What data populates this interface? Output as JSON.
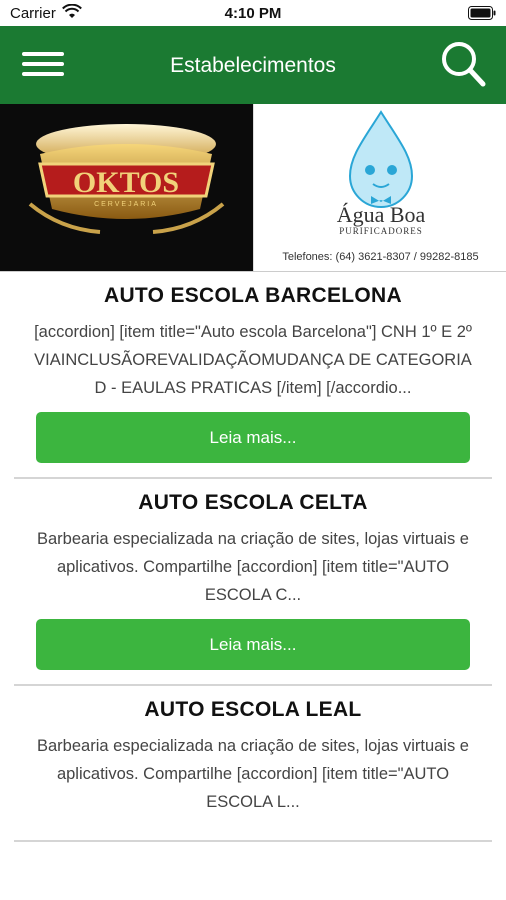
{
  "status_bar": {
    "carrier": "Carrier",
    "time": "4:10 PM"
  },
  "nav": {
    "title": "Estabelecimentos"
  },
  "banner": {
    "left_brand": "OKTOS",
    "left_sub": "CERVEJARIA",
    "right_brand": "Água Boa",
    "right_sub": "PURIFICADORES",
    "right_phones": "Telefones: (64) 3621-8307 / 99282-8185"
  },
  "items": [
    {
      "title": "AUTO ESCOLA BARCELONA",
      "description": "[accordion] [item title=\"Auto escola Barcelona\"] CNH 1º E 2º VIAINCLUSÃOREVALIDAÇÃOMUDANÇA DE CATEGORIA D - EAULAS PRATICAS [/item] [/accordio...",
      "button": "Leia mais..."
    },
    {
      "title": "AUTO ESCOLA CELTA",
      "description": "Barbearia especializada na criação de sites, lojas virtuais e aplicativos.  Compartilhe   [accordion] [item title=\"AUTO ESCOLA C...",
      "button": "Leia mais..."
    },
    {
      "title": "AUTO ESCOLA LEAL",
      "description": "Barbearia especializada na criação de sites, lojas virtuais e aplicativos.  Compartilhe   [accordion] [item title=\"AUTO ESCOLA L...",
      "button": ""
    }
  ],
  "colors": {
    "nav_green": "#1b7a32",
    "button_green": "#3cb53f"
  },
  "icons": [
    "wifi-icon",
    "battery-icon",
    "menu-icon",
    "search-icon"
  ]
}
